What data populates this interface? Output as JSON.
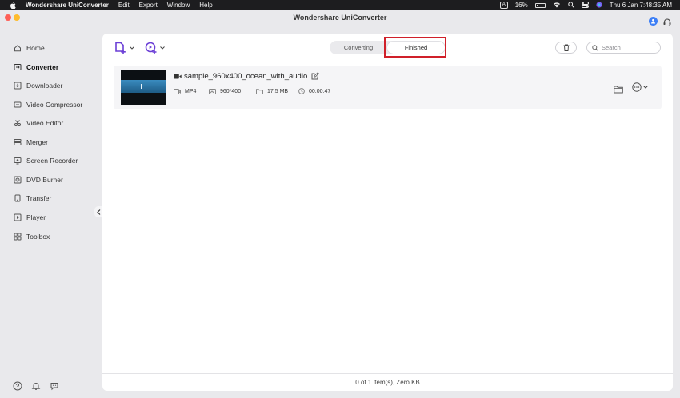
{
  "menubar": {
    "app_name": "Wondershare UniConverter",
    "items": [
      "Edit",
      "Export",
      "Window",
      "Help"
    ],
    "input_indicator": "A",
    "battery": "16%",
    "datetime": "Thu 6 Jan  7:48:35 AM"
  },
  "window": {
    "title": "Wondershare UniConverter"
  },
  "sidebar": {
    "items": [
      {
        "label": "Home",
        "icon": "home-icon"
      },
      {
        "label": "Converter",
        "icon": "converter-icon",
        "active": true
      },
      {
        "label": "Downloader",
        "icon": "downloader-icon"
      },
      {
        "label": "Video Compressor",
        "icon": "video-compressor-icon"
      },
      {
        "label": "Video Editor",
        "icon": "video-editor-icon"
      },
      {
        "label": "Merger",
        "icon": "merger-icon"
      },
      {
        "label": "Screen Recorder",
        "icon": "screen-recorder-icon"
      },
      {
        "label": "DVD Burner",
        "icon": "dvd-burner-icon"
      },
      {
        "label": "Transfer",
        "icon": "transfer-icon"
      },
      {
        "label": "Player",
        "icon": "player-icon"
      },
      {
        "label": "Toolbox",
        "icon": "toolbox-icon"
      }
    ]
  },
  "tabs": {
    "converting": "Converting",
    "finished": "Finished",
    "selected": "Finished"
  },
  "search": {
    "placeholder": "Search"
  },
  "file": {
    "name": "sample_960x400_ocean_with_audio",
    "format": "MP4",
    "resolution": "960*400",
    "size": "17.5 MB",
    "duration": "00:00:47"
  },
  "footer": {
    "status": "0 of 1 item(s), Zero KB"
  },
  "colors": {
    "accent": "#3d7ff6",
    "highlight": "#d0202a",
    "add_icon": "#6b3fd6"
  }
}
